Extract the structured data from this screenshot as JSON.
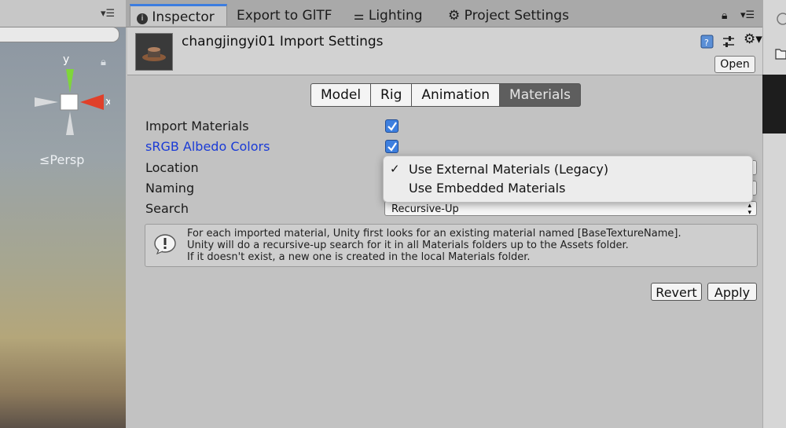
{
  "tabs": {
    "inspector": "Inspector",
    "export_gltf": "Export to GlTF",
    "lighting": "Lighting",
    "project_settings": "Project Settings"
  },
  "scene": {
    "axis_y": "y",
    "axis_x": "x",
    "persp": "Persp"
  },
  "header": {
    "title": "changjingyi01 Import Settings",
    "open": "Open"
  },
  "subtabs": [
    "Model",
    "Rig",
    "Animation",
    "Materials"
  ],
  "fields": {
    "import_materials": "Import Materials",
    "srgb_albedo": "sRGB Albedo Colors",
    "location": "Location",
    "naming": "Naming",
    "search": "Search",
    "search_value": "Recursive-Up"
  },
  "popup": {
    "options": [
      "Use External Materials (Legacy)",
      "Use Embedded Materials"
    ],
    "selected_index": 0
  },
  "help": {
    "lines": [
      "For each imported material, Unity first looks for an existing material named [BaseTextureName].",
      "Unity will do a recursive-up search for it in all Materials folders up to the Assets folder.",
      "If it doesn't exist, a new one is created in the local Materials folder."
    ]
  },
  "buttons": {
    "revert": "Revert",
    "apply": "Apply"
  },
  "colors": {
    "accent": "#3d7fdf",
    "srgb_label": "#1a3bd6"
  }
}
